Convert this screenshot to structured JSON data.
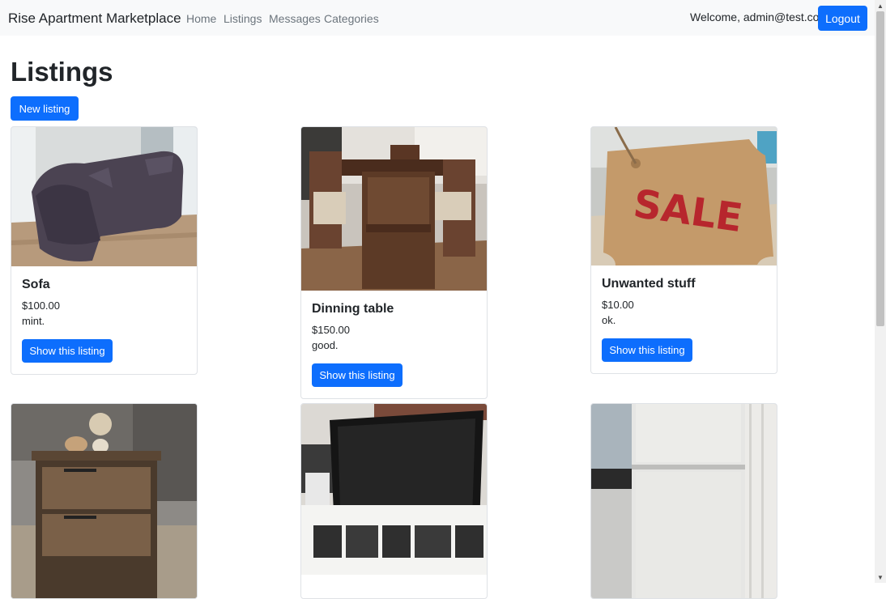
{
  "navbar": {
    "brand": "Rise Apartment Marketplace",
    "links": [
      "Home",
      "Listings",
      "Messages",
      "Categories"
    ],
    "welcome": "Welcome, admin@test.com",
    "logout": "Logout"
  },
  "page": {
    "title": "Listings",
    "new_listing": "New listing"
  },
  "listings": [
    {
      "title": "Sofa",
      "price": "$100.00",
      "description": "mint.",
      "button": "Show this listing",
      "image": "sofa-photo"
    },
    {
      "title": "Dinning table",
      "price": "$150.00",
      "description": "good.",
      "button": "Show this listing",
      "image": "dining-table-photo"
    },
    {
      "title": "Unwanted stuff",
      "price": "$10.00",
      "description": "ok.",
      "button": "Show this listing",
      "image": "sale-tag-photo"
    },
    {
      "image": "bedside-drawers-photo"
    },
    {
      "image": "tv-stand-photo"
    },
    {
      "image": "fridge-photo"
    }
  ],
  "colors": {
    "primary": "#0d6efd",
    "navbar_bg": "#f8f9fa",
    "muted": "#6c757d"
  }
}
